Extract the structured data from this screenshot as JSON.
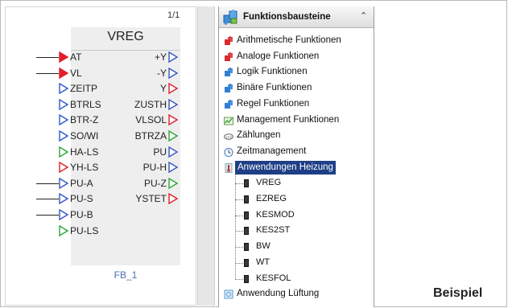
{
  "canvas": {
    "page_indicator": "1/1",
    "block_title": "VREG",
    "block_instance": "FB_1",
    "colors": {
      "connected": "#e0202a",
      "unconnected_in": "#3557c6",
      "green": "#2aa835",
      "red_outline": "#e0202a"
    },
    "inputs": [
      {
        "label": "AT",
        "style": "red-filled",
        "wired": true
      },
      {
        "label": "VL",
        "style": "red-filled",
        "wired": true
      },
      {
        "label": "ZEITP",
        "style": "blue",
        "wired": false
      },
      {
        "label": "BTRLS",
        "style": "blue",
        "wired": false
      },
      {
        "label": "BTR-Z",
        "style": "blue",
        "wired": false
      },
      {
        "label": "SO/WI",
        "style": "blue",
        "wired": false
      },
      {
        "label": "HA-LS",
        "style": "green",
        "wired": false
      },
      {
        "label": "YH-LS",
        "style": "red",
        "wired": false
      },
      {
        "label": "PU-A",
        "style": "blue",
        "wired": true
      },
      {
        "label": "PU-S",
        "style": "blue",
        "wired": true
      },
      {
        "label": "PU-B",
        "style": "blue",
        "wired": true
      },
      {
        "label": "PU-LS",
        "style": "green",
        "wired": false
      }
    ],
    "outputs": [
      {
        "label": "+Y",
        "style": "blue"
      },
      {
        "label": "-Y",
        "style": "blue"
      },
      {
        "label": "Y",
        "style": "red"
      },
      {
        "label": "ZUSTH",
        "style": "blue"
      },
      {
        "label": "VLSOL",
        "style": "red"
      },
      {
        "label": "BTRZA",
        "style": "green"
      },
      {
        "label": "PU",
        "style": "blue"
      },
      {
        "label": "PU-H",
        "style": "blue"
      },
      {
        "label": "PU-Z",
        "style": "green"
      },
      {
        "label": "YSTET",
        "style": "red"
      }
    ]
  },
  "tree": {
    "title": "Funktionsbausteine",
    "collapse_glyph": "⌃",
    "categories": [
      {
        "label": "Arithmetische Funktionen",
        "icon": "puzzle-red-icon",
        "color": "#d92b2b"
      },
      {
        "label": "Analoge Funktionen",
        "icon": "puzzle-red-icon",
        "color": "#d92b2b"
      },
      {
        "label": "Logik Funktionen",
        "icon": "puzzle-blue-icon",
        "color": "#2e7fd6"
      },
      {
        "label": "Binäre Funktionen",
        "icon": "puzzle-blue-icon",
        "color": "#2e7fd6"
      },
      {
        "label": "Regel Funktionen",
        "icon": "puzzle-blue-icon",
        "color": "#2e7fd6"
      },
      {
        "label": "Management Funktionen",
        "icon": "chart-icon",
        "color": "#4aa24a"
      },
      {
        "label": "Zählungen",
        "icon": "counter-icon",
        "color": "#777777"
      },
      {
        "label": "Zeitmanagement",
        "icon": "clock-icon",
        "color": "#5b8fc9"
      },
      {
        "label": "Anwendungen Heizung",
        "icon": "thermometer-icon",
        "color": "#c0392b",
        "selected": true
      },
      {
        "label": "Anwendung Lüftung",
        "icon": "fan-icon",
        "color": "#5b9bd5"
      }
    ],
    "children": [
      "VREG",
      "EZREG",
      "KESMOD",
      "KES2ST",
      "BW",
      "WT",
      "KESFOL"
    ]
  },
  "caption": "Beispiel"
}
